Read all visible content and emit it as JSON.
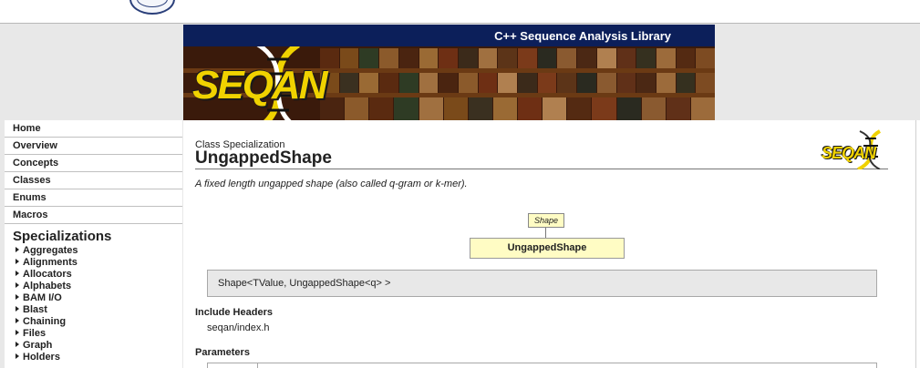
{
  "banner": {
    "subtitle": "C++ Sequence Analysis Library",
    "logo_text": "SEQAN"
  },
  "sidebar": {
    "nav": [
      {
        "label": "Home"
      },
      {
        "label": "Overview"
      },
      {
        "label": "Concepts"
      },
      {
        "label": "Classes"
      },
      {
        "label": "Enums"
      },
      {
        "label": "Macros"
      }
    ],
    "specializations_title": "Specializations",
    "specializations": [
      {
        "label": "Aggregates"
      },
      {
        "label": "Alignments"
      },
      {
        "label": "Allocators"
      },
      {
        "label": "Alphabets"
      },
      {
        "label": "BAM I/O"
      },
      {
        "label": "Blast"
      },
      {
        "label": "Chaining"
      },
      {
        "label": "Files"
      },
      {
        "label": "Graph"
      },
      {
        "label": "Holders"
      }
    ]
  },
  "page": {
    "kind": "Class Specialization",
    "title": "UngappedShape",
    "small_logo_text": "SEQAN",
    "description": "A fixed length ungapped shape (also called q-gram or k-mer).",
    "diagram": {
      "parent": "Shape",
      "current": "UngappedShape"
    },
    "signature": "Shape<TValue, UngappedShape<q> >",
    "include_headers_label": "Include Headers",
    "include_header": "seqan/index.h",
    "parameters_label": "Parameters"
  },
  "colors": {
    "banner_bar": "#0c1f5a",
    "logo_yellow": "#f0d200",
    "diagram_box": "#fffcc4"
  }
}
